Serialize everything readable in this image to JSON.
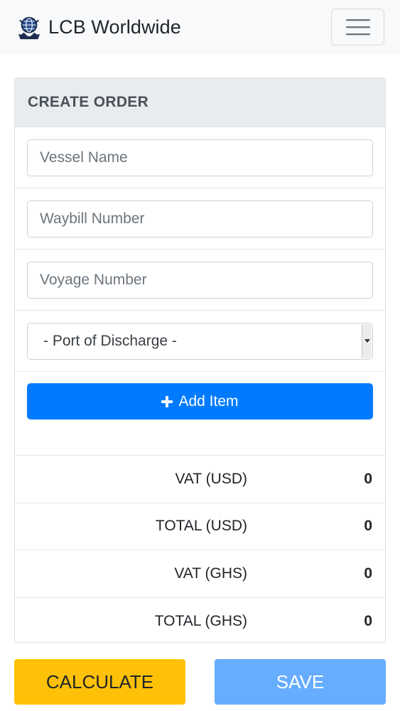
{
  "app": {
    "brand": "LCB Worldwide",
    "logo_icon": "globe-ship-logo-icon",
    "menu_icon": "hamburger-menu-icon"
  },
  "form": {
    "title": "CREATE ORDER",
    "vessel_name": {
      "value": "",
      "placeholder": "Vessel Name"
    },
    "waybill_number": {
      "value": "",
      "placeholder": "Waybill Number"
    },
    "voyage_number": {
      "value": "",
      "placeholder": "Voyage Number"
    },
    "port_of_discharge": {
      "selected": "- Port of Discharge -"
    },
    "add_item_label": "Add Item",
    "add_item_icon": "plus-icon"
  },
  "summary": [
    {
      "label": "VAT (USD)",
      "value": "0"
    },
    {
      "label": "TOTAL (USD)",
      "value": "0"
    },
    {
      "label": "VAT (GHS)",
      "value": "0"
    },
    {
      "label": "TOTAL (GHS)",
      "value": "0"
    }
  ],
  "actions": {
    "calculate_label": "CALCULATE",
    "save_label": "SAVE"
  },
  "colors": {
    "primary": "#007bff",
    "calculate": "#ffc107",
    "save_disabled": "#66adff",
    "navbar_bg": "#f8f9fa",
    "header_bg": "#e9ecef"
  }
}
